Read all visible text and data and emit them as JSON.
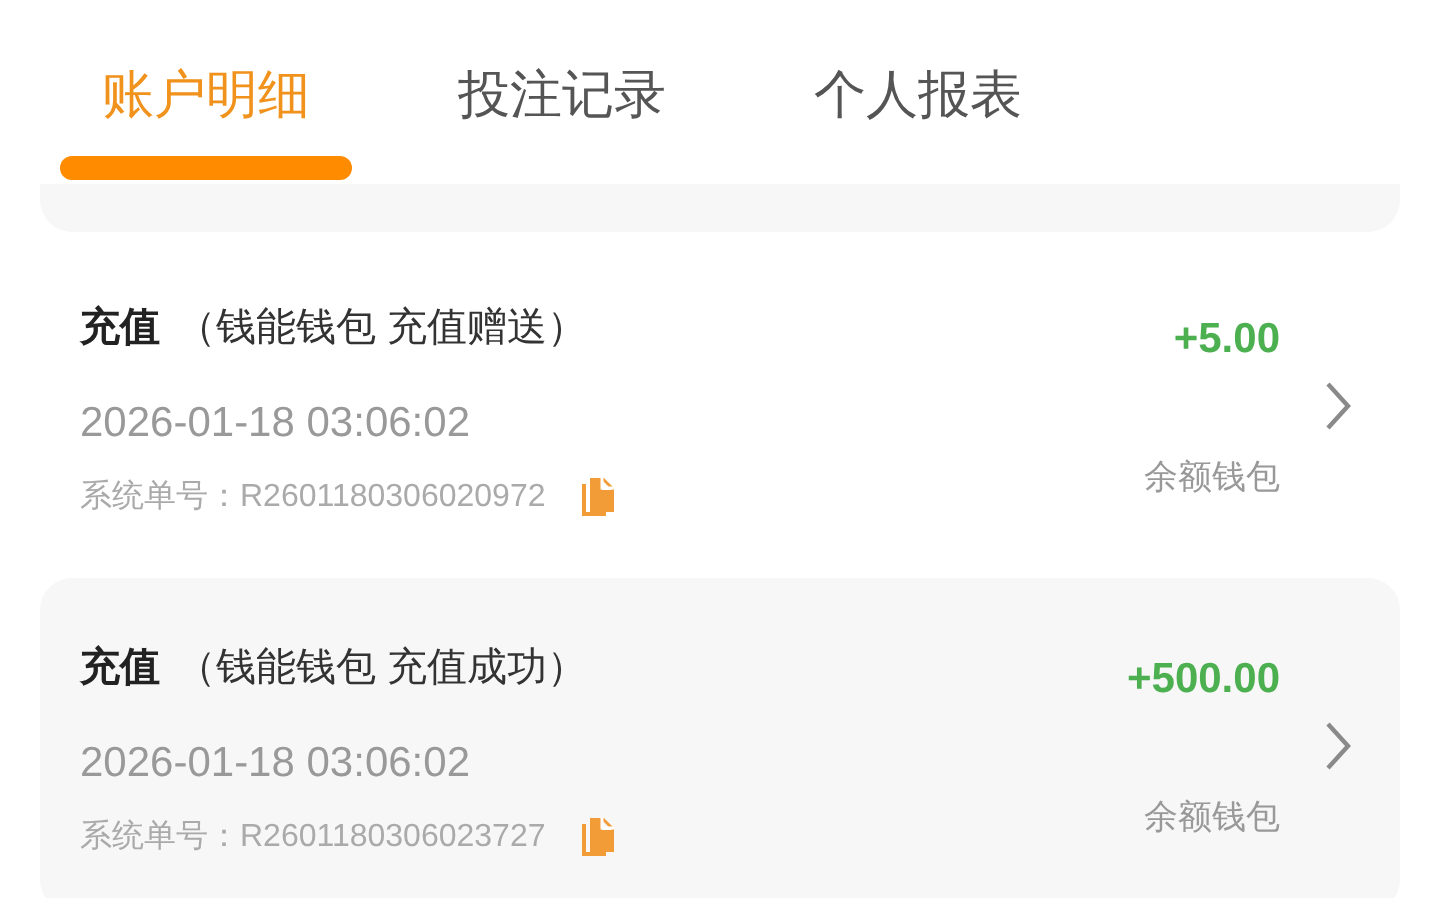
{
  "tabs": [
    {
      "label": "账户明细",
      "selected": true
    },
    {
      "label": "投注记录",
      "selected": false
    },
    {
      "label": "个人报表",
      "selected": false
    }
  ],
  "records": [
    {
      "type": "充值",
      "note": "（钱能钱包 充值赠送）",
      "time": "2026-01-18 03:06:02",
      "order_label": "系统单号：",
      "order_no": "R2601180306020972",
      "amount": "+5.00",
      "wallet": "余额钱包"
    },
    {
      "type": "充值",
      "note": "（钱能钱包 充值成功）",
      "time": "2026-01-18 03:06:02",
      "order_label": "系统单号：",
      "order_no": "R2601180306023727",
      "amount": "+500.00",
      "wallet": "余额钱包"
    }
  ]
}
